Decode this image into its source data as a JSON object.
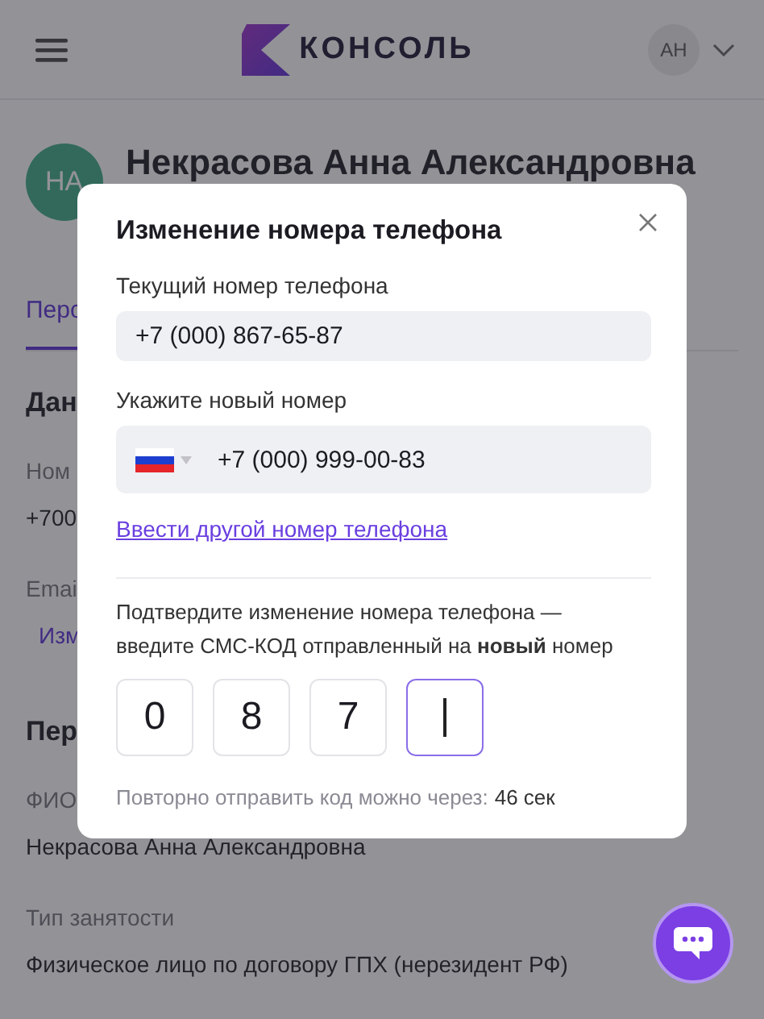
{
  "header": {
    "logo_text": "КОНСОЛЬ",
    "user_initials": "АН"
  },
  "profile": {
    "avatar": "НА",
    "name": "Некрасова Анна Александровна",
    "tabs": [
      {
        "label": "Перс",
        "selected": true
      }
    ],
    "fields": [
      {
        "kind": "heading",
        "text": "Дан"
      },
      {
        "kind": "label",
        "text": "Ном"
      },
      {
        "kind": "value",
        "text": "+700"
      },
      {
        "kind": "label",
        "text": "Emai"
      },
      {
        "kind": "link",
        "text": "Изм"
      },
      {
        "kind": "heading",
        "text": "Пер"
      },
      {
        "kind": "label",
        "text": "ФИО"
      },
      {
        "kind": "value",
        "text": "Некрасова Анна Александровна"
      },
      {
        "kind": "label",
        "text": "Тип занятости"
      },
      {
        "kind": "value",
        "text": "Физическое лицо по договору ГПХ (нерезидент РФ)"
      }
    ]
  },
  "modal": {
    "title": "Изменение номера телефона",
    "current_label": "Текущий номер телефона",
    "current_value": "+7 (000) 867-65-87",
    "new_label": "Укажите новый номер",
    "new_value": "+7 (000) 999-00-83",
    "link": "Ввести другой номер телефона",
    "confirm_text": "Подтвердите изменение номера телефона — введите СМС-КОД отправленный на **новый** номер",
    "code_cells": [
      {
        "value": "0",
        "focused": false
      },
      {
        "value": "8",
        "focused": false
      },
      {
        "value": "7",
        "focused": false
      },
      {
        "focused": true
      }
    ],
    "resend_text": "Повторно отправить код можно через:",
    "resend_time": "46 сек"
  }
}
